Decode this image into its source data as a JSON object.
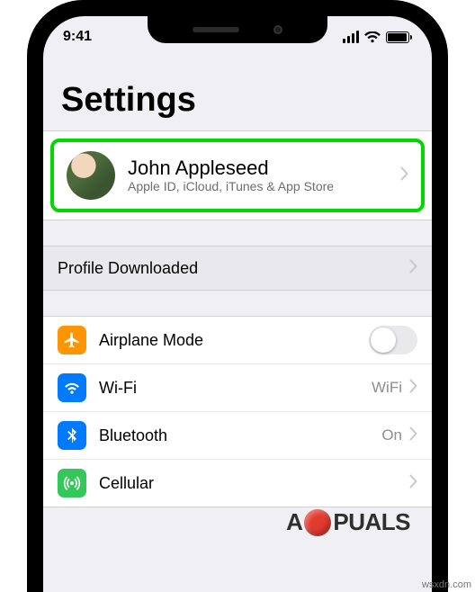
{
  "status": {
    "time": "9:41"
  },
  "page": {
    "title": "Settings"
  },
  "apple_id": {
    "name": "John Appleseed",
    "subtitle": "Apple ID, iCloud, iTunes & App Store"
  },
  "profile": {
    "label": "Profile Downloaded"
  },
  "rows": {
    "airplane": {
      "label": "Airplane Mode"
    },
    "wifi": {
      "label": "Wi-Fi",
      "value": "WiFi"
    },
    "bluetooth": {
      "label": "Bluetooth",
      "value": "On"
    },
    "cellular": {
      "label": "Cellular"
    }
  },
  "watermark": {
    "left": "A",
    "right": "PUALS"
  },
  "credit": "wsxdn.com"
}
